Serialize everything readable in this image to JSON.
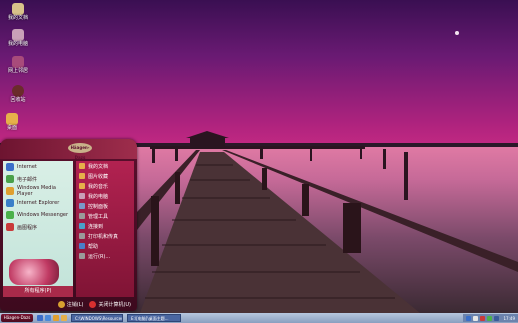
{
  "desktop_icons": [
    {
      "label": "我的文档",
      "color": "#d9c28a"
    },
    {
      "label": "我的电脑",
      "color": "#c9a0b8"
    },
    {
      "label": "网上邻居",
      "color": "#a84b7b"
    },
    {
      "label": "回收站",
      "color": "#6a2b2b"
    },
    {
      "label": "桌面",
      "color": "#e6b04a"
    }
  ],
  "start_menu": {
    "logo": "Häagen-Dazs",
    "left_items": [
      {
        "label": "Internet",
        "color": "#3a6ec9"
      },
      {
        "label": "电子邮件",
        "color": "#4aa04a"
      },
      {
        "label": "Windows Media Player",
        "color": "#e0a030"
      },
      {
        "label": "Internet Explorer",
        "color": "#3a7ec9"
      },
      {
        "label": "Windows Messenger",
        "color": "#4ab04a"
      },
      {
        "label": "画图程序",
        "color": "#c93a3a"
      }
    ],
    "all_programs": "所有程序(P)",
    "right_items": [
      {
        "label": "我的文档",
        "color": "#e6b04a"
      },
      {
        "label": "图片收藏",
        "color": "#e6b04a"
      },
      {
        "label": "我的音乐",
        "color": "#e6b04a"
      },
      {
        "label": "我的电脑",
        "color": "#c9a0b8"
      },
      {
        "label": "控制面板",
        "color": "#7a9ac9"
      },
      {
        "label": "管理工具",
        "color": "#9a9a9a"
      },
      {
        "label": "连接到",
        "color": "#4aa0c9"
      },
      {
        "label": "打印机和传真",
        "color": "#9a9a9a"
      },
      {
        "label": "帮助",
        "color": "#4a7ec9"
      },
      {
        "label": "运行(R)...",
        "color": "#9a9a9a"
      }
    ],
    "logoff": "注销(L)",
    "shutdown": "关闭计算机(U)"
  },
  "taskbar": {
    "start_label": "Häagen-Dazs",
    "tasks": [
      "C:\\WINDOWS\\Resources...",
      "E:\\[电脑]\\桌面主题..."
    ],
    "clock": "17:49"
  }
}
